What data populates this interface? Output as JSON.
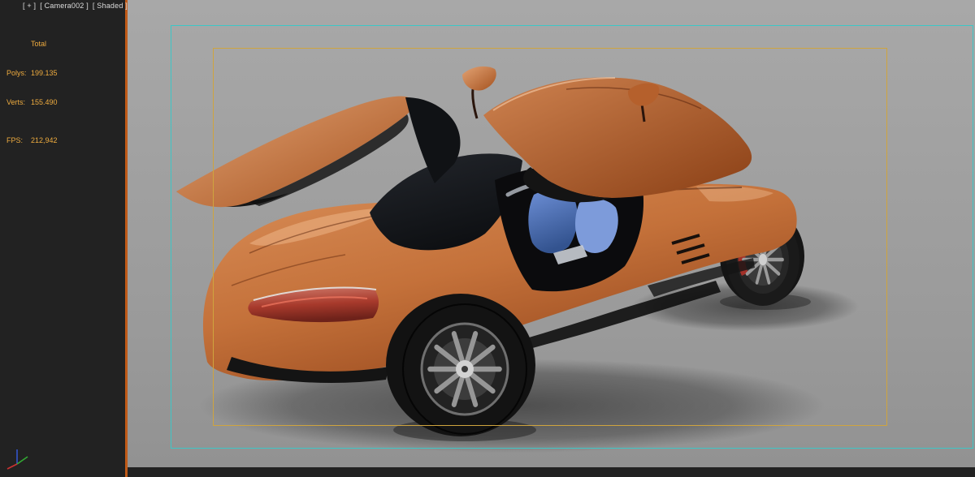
{
  "viewport_label": {
    "general_menu": "[ + ]",
    "pov_menu": "[ Camera002 ]",
    "shading_menu": "[ Shaded ]"
  },
  "statistics": {
    "total_label": "Total",
    "polys_label": "Polys:",
    "polys_value": "199.135",
    "verts_label": "Verts:",
    "verts_value": "155.490",
    "fps_label": "FPS:",
    "fps_value": "212,942"
  },
  "icons": {
    "world_axis": "world-axis-tripod"
  },
  "colors": {
    "stats_text": "#efac3f",
    "active_viewport_border": "#c05a18",
    "safe_frame_outer": "#3cc7c7",
    "safe_frame_inner": "#cfa43e",
    "viewport_background": "#9e9e9e",
    "panel_background": "#222222",
    "car_body": "#c06a33",
    "car_interior": "#4a6fb5",
    "axis_x": "#cc3333",
    "axis_y": "#33aa33",
    "axis_z": "#3355cc"
  }
}
